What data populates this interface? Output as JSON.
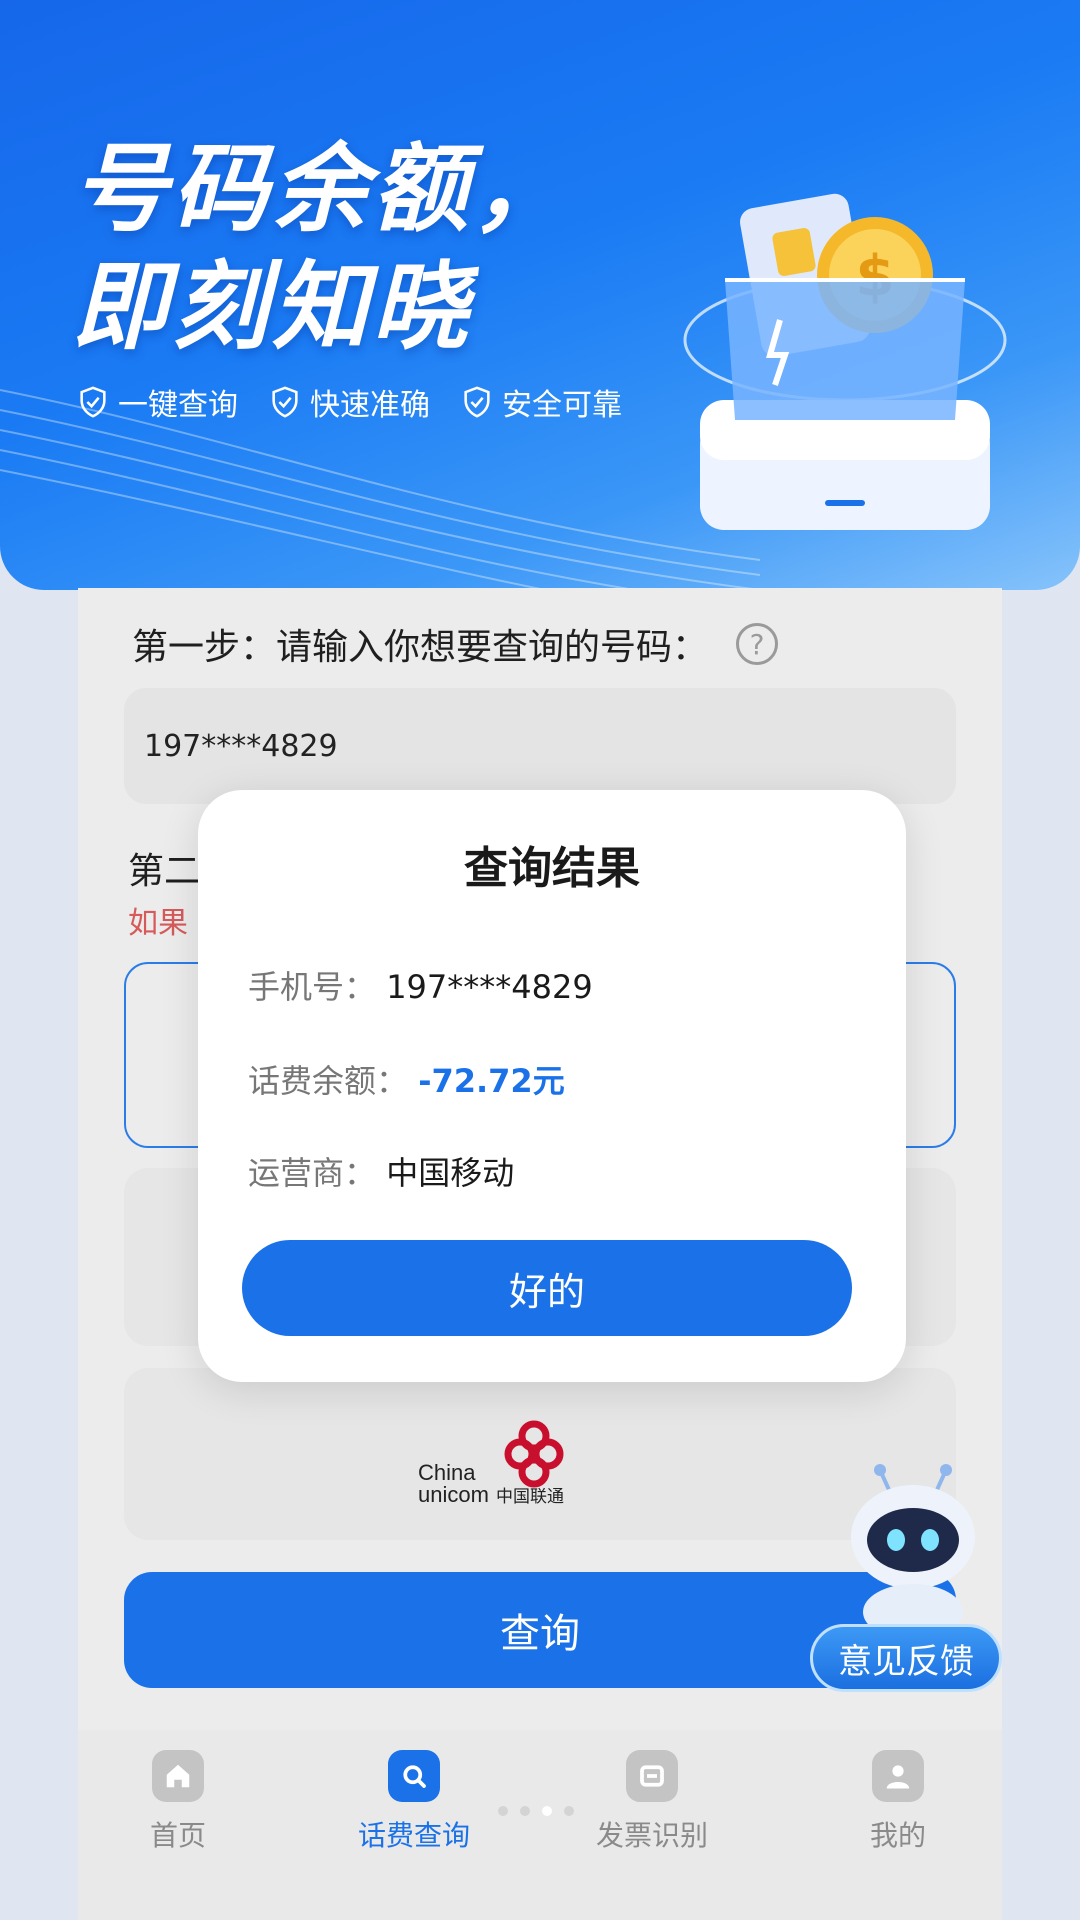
{
  "banner": {
    "title_line1": "号码余额，",
    "title_line2": "即刻知晓",
    "tags": [
      "一键查询",
      "快速准确",
      "安全可靠"
    ]
  },
  "form": {
    "step1_label": "第一步：请输入你想要查询的号码：",
    "help_icon": "?",
    "phone_value": "197****4829",
    "step2_label_visible": "第二",
    "hint_visible": "如果",
    "query_button": "查询"
  },
  "operators": {
    "unicom_logo_text": "China unicom中国联通"
  },
  "dialog": {
    "title": "查询结果",
    "phone_label": "手机号：",
    "phone_value": "197****4829",
    "balance_label": "话费余额：",
    "balance_value": "-72.72元",
    "carrier_label": "运营商：",
    "carrier_value": "中国移动",
    "ok_button": "好的"
  },
  "feedback": {
    "label": "意见反馈"
  },
  "tabbar": {
    "items": [
      {
        "label": "首页",
        "icon": "home-icon"
      },
      {
        "label": "话费查询",
        "icon": "search-icon",
        "active": true
      },
      {
        "label": "发票识别",
        "icon": "invoice-icon"
      },
      {
        "label": "我的",
        "icon": "user-icon"
      }
    ]
  },
  "colors": {
    "primary": "#1b72e8",
    "banner": "#1a7bf4",
    "hint_red": "#d65a5a"
  }
}
